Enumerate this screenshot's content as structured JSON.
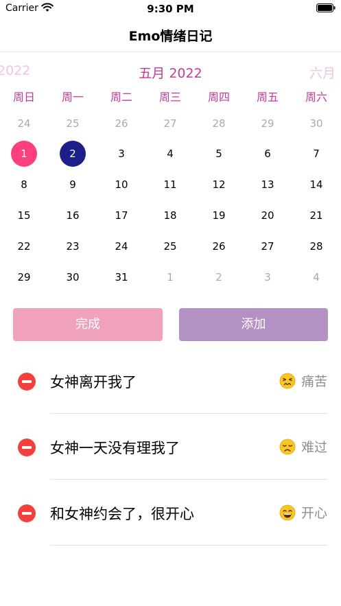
{
  "status_bar": {
    "carrier": "Carrier",
    "time": "9:30 PM"
  },
  "nav": {
    "title": "Emo情绪日记"
  },
  "calendar": {
    "prev_label": "2022",
    "current_label": "五月 2022",
    "next_label": "六月",
    "weekdays": [
      "周日",
      "周一",
      "周二",
      "周三",
      "周四",
      "周五",
      "周六"
    ],
    "weeks": [
      [
        "24",
        "25",
        "26",
        "27",
        "28",
        "29",
        "30"
      ],
      [
        "1",
        "2",
        "3",
        "4",
        "5",
        "6",
        "7"
      ],
      [
        "8",
        "9",
        "10",
        "11",
        "12",
        "13",
        "14"
      ],
      [
        "15",
        "16",
        "17",
        "18",
        "19",
        "20",
        "21"
      ],
      [
        "22",
        "23",
        "24",
        "25",
        "26",
        "27",
        "28"
      ],
      [
        "29",
        "30",
        "31",
        "1",
        "2",
        "3",
        "4"
      ]
    ],
    "today_day": "1",
    "selected_day": "2",
    "accent_color": "#c13a9d",
    "today_color": "#ff3f7e",
    "selected_color": "#1c1f8a"
  },
  "actions": {
    "done_label": "完成",
    "add_label": "添加",
    "done_color": "#f0a2bb",
    "add_color": "#b391c4"
  },
  "entries": [
    {
      "title": "女神离开我了",
      "mood_label": "痛苦",
      "mood_icon": "persevering-face-icon"
    },
    {
      "title": "女神一天没有理我了",
      "mood_label": "难过",
      "mood_icon": "disappointed-face-icon"
    },
    {
      "title": "和女神约会了，很开心",
      "mood_label": "开心",
      "mood_icon": "grinning-face-icon"
    }
  ]
}
